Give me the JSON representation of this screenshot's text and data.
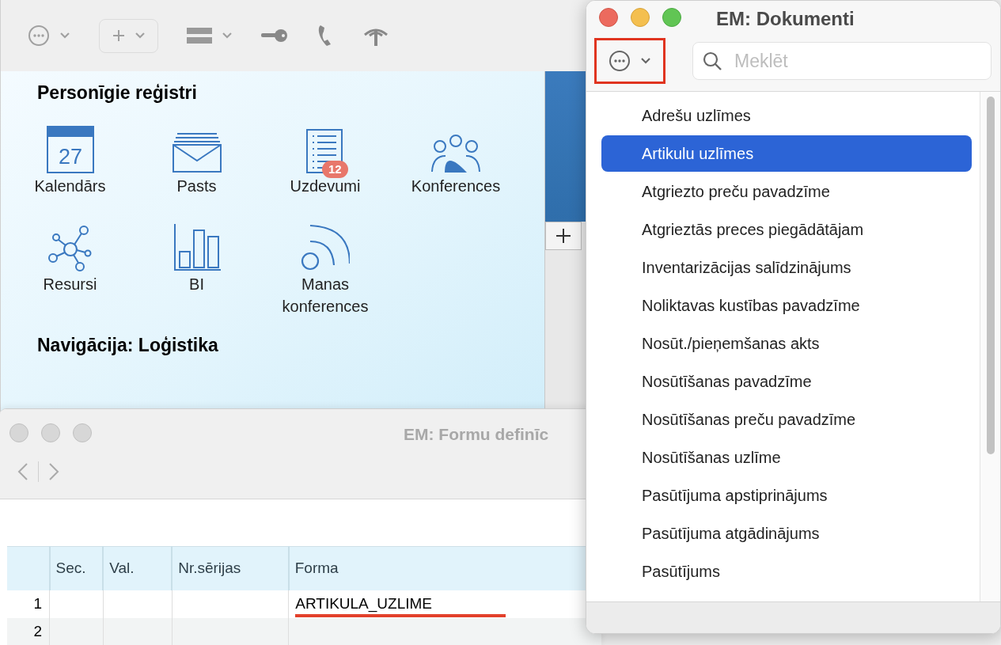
{
  "main_window": {
    "sections": [
      {
        "title": "Personīgie reģistri",
        "tiles": [
          {
            "kind": "calendar",
            "icon_text": "27",
            "label": "Kalendārs"
          },
          {
            "kind": "mail",
            "label": "Pasts"
          },
          {
            "kind": "tasks",
            "label": "Uzdevumi",
            "badge": "12"
          },
          {
            "kind": "people",
            "label": "Konferences"
          },
          {
            "kind": "network",
            "label": "Resursi"
          },
          {
            "kind": "chart",
            "label": "BI"
          },
          {
            "kind": "signal",
            "label": "Manas konferences"
          }
        ]
      },
      {
        "title": "Navigācija: Loģistika"
      }
    ]
  },
  "forms_window": {
    "title": "EM: Formu definīc",
    "table": {
      "columns": [
        "Sec.",
        "Val.",
        "Nr.sērijas",
        "Forma"
      ],
      "rows": [
        {
          "number": "1",
          "cells": [
            "",
            "",
            "",
            "ARTIKULA_UZLIME"
          ],
          "underlined": true
        },
        {
          "number": "2",
          "cells": [
            "",
            "",
            "",
            ""
          ],
          "underlined": false
        }
      ]
    }
  },
  "documents_window": {
    "title": "EM: Dokumenti",
    "menu_button": {
      "highlighted": true
    },
    "search": {
      "placeholder": "Meklēt"
    },
    "items": [
      {
        "label": "Adrešu uzlīmes",
        "selected": false
      },
      {
        "label": "Artikulu uzlīmes",
        "selected": true
      },
      {
        "label": "Atgriezto preču pavadzīme",
        "selected": false
      },
      {
        "label": "Atgrieztās preces piegādātājam",
        "selected": false
      },
      {
        "label": "Inventarizācijas salīdzinājums",
        "selected": false
      },
      {
        "label": "Noliktavas kustības pavadzīme",
        "selected": false
      },
      {
        "label": "Nosūt./pieņemšanas akts",
        "selected": false
      },
      {
        "label": "Nosūtīšanas pavadzīme",
        "selected": false
      },
      {
        "label": "Nosūtīšanas preču pavadzīme",
        "selected": false
      },
      {
        "label": "Nosūtīšanas uzlīme",
        "selected": false
      },
      {
        "label": "Pasūtījuma apstiprinājums",
        "selected": false
      },
      {
        "label": "Pasūtījuma atgādinājums",
        "selected": false
      },
      {
        "label": "Pasūtījums",
        "selected": false
      }
    ]
  }
}
